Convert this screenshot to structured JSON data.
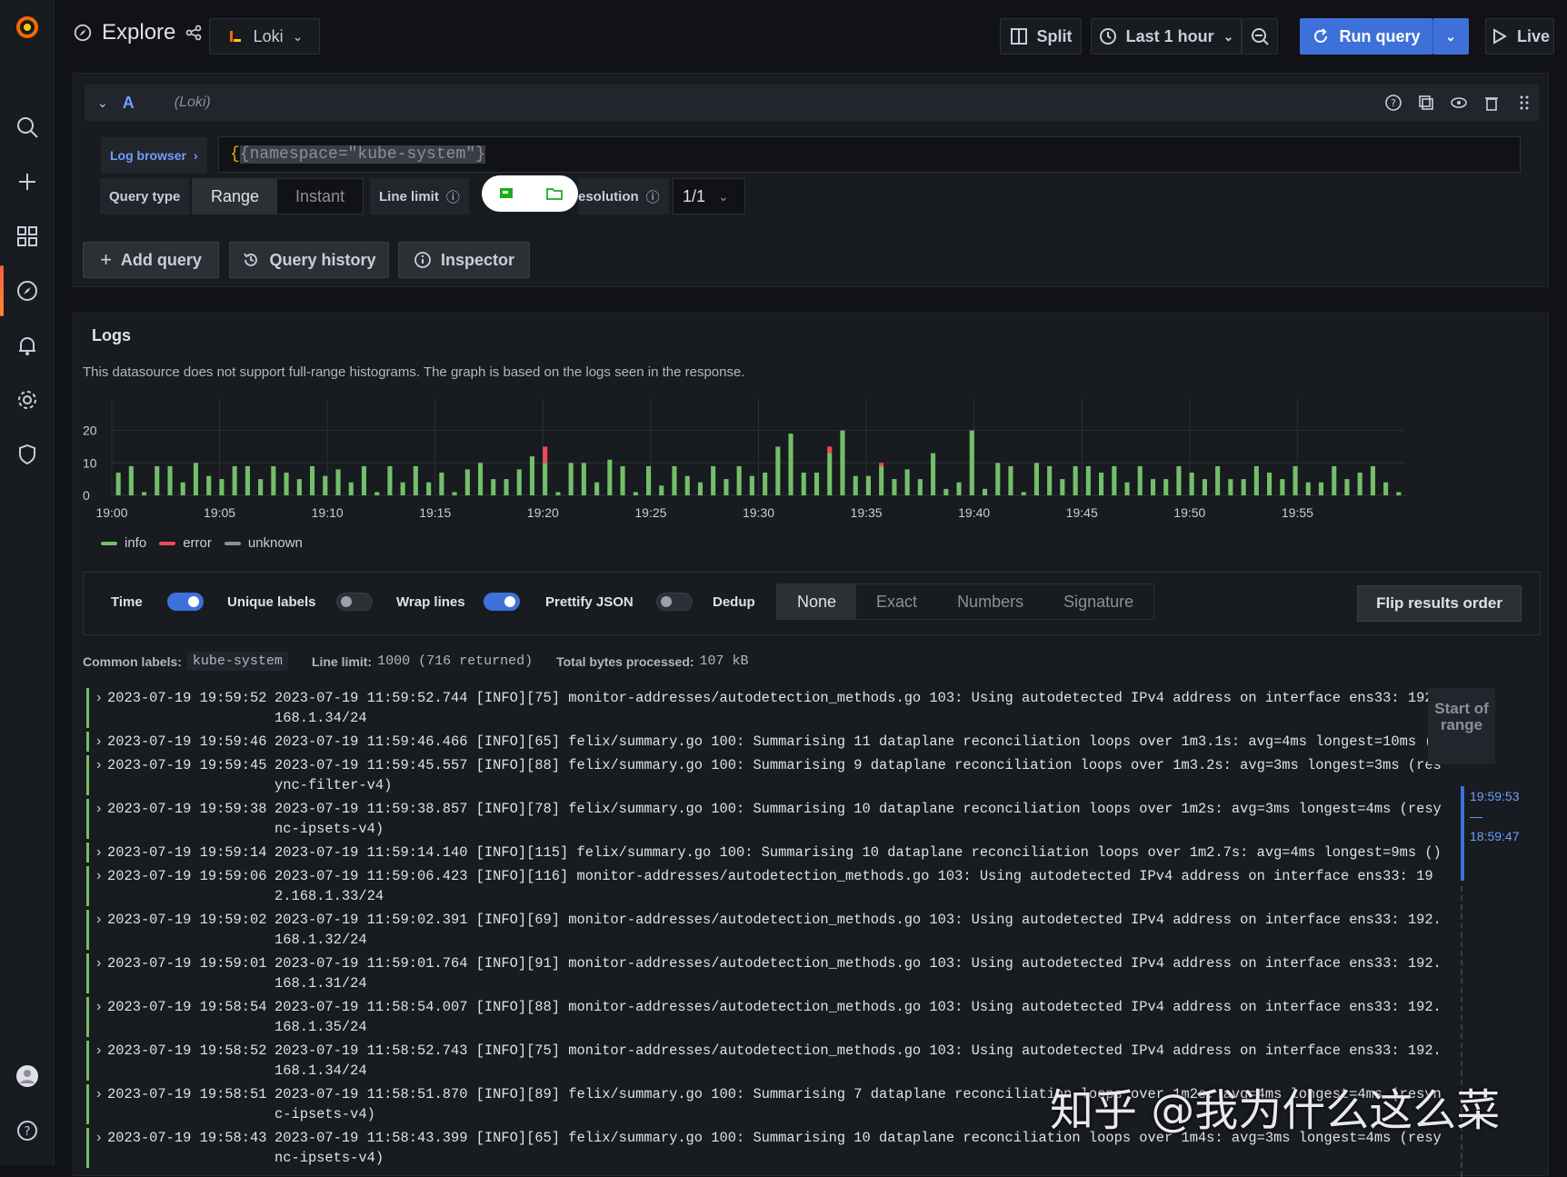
{
  "topbar": {
    "title": "Explore",
    "datasource": "Loki",
    "split_label": "Split",
    "time_range": "Last 1 hour",
    "run_query_label": "Run query",
    "live_label": "Live"
  },
  "query": {
    "ref_id": "A",
    "datasource_hint": "(Loki)",
    "log_browser_label": "Log browser",
    "expression": "{namespace=\"kube-system\"}",
    "query_type_label": "Query type",
    "query_type_options": [
      "Range",
      "Instant"
    ],
    "query_type_selected": "Range",
    "line_limit_label": "Line limit",
    "resolution_label": "esolution",
    "resolution_value": "1/1",
    "add_query_label": "Add query",
    "query_history_label": "Query history",
    "inspector_label": "Inspector"
  },
  "logs": {
    "title": "Logs",
    "note": "This datasource does not support full-range histograms. The graph is based on the logs seen in the response.",
    "legend": [
      {
        "name": "info",
        "color": "#73bf69"
      },
      {
        "name": "error",
        "color": "#f2495c"
      },
      {
        "name": "unknown",
        "color": "#8e8e9a"
      }
    ],
    "options": {
      "time_label": "Time",
      "unique_labels_label": "Unique labels",
      "wrap_lines_label": "Wrap lines",
      "prettify_json_label": "Prettify JSON",
      "dedup_label": "Dedup",
      "dedup_options": [
        "None",
        "Exact",
        "Numbers",
        "Signature"
      ],
      "dedup_selected": "None",
      "flip_label": "Flip results order"
    },
    "common_labels_label": "Common labels:",
    "common_labels_value": "kube-system",
    "line_limit_label": "Line limit:",
    "line_limit_value": "1000 (716 returned)",
    "bytes_label": "Total bytes processed:",
    "bytes_value": "107 kB",
    "range_label": "Start of range",
    "range_from": "19:59:53",
    "range_dash": "—",
    "range_to": "18:59:47",
    "rows": [
      {
        "ts": "2023-07-19 19:59:52",
        "msg": "2023-07-19 11:59:52.744 [INFO][75] monitor-addresses/autodetection_methods.go 103: Using autodetected IPv4 address on interface ens33: 192.168.1.34/24"
      },
      {
        "ts": "2023-07-19 19:59:46",
        "msg": "2023-07-19 11:59:46.466 [INFO][65] felix/summary.go 100: Summarising 11 dataplane reconciliation loops over 1m3.1s: avg=4ms longest=10ms ()"
      },
      {
        "ts": "2023-07-19 19:59:45",
        "msg": "2023-07-19 11:59:45.557 [INFO][88] felix/summary.go 100: Summarising 9 dataplane reconciliation loops over 1m3.2s: avg=3ms longest=3ms (resync-filter-v4)"
      },
      {
        "ts": "2023-07-19 19:59:38",
        "msg": "2023-07-19 11:59:38.857 [INFO][78] felix/summary.go 100: Summarising 10 dataplane reconciliation loops over 1m2s: avg=3ms longest=4ms (resync-ipsets-v4)"
      },
      {
        "ts": "2023-07-19 19:59:14",
        "msg": "2023-07-19 11:59:14.140 [INFO][115] felix/summary.go 100: Summarising 10 dataplane reconciliation loops over 1m2.7s: avg=4ms longest=9ms ()"
      },
      {
        "ts": "2023-07-19 19:59:06",
        "msg": "2023-07-19 11:59:06.423 [INFO][116] monitor-addresses/autodetection_methods.go 103: Using autodetected IPv4 address on interface ens33: 192.168.1.33/24"
      },
      {
        "ts": "2023-07-19 19:59:02",
        "msg": "2023-07-19 11:59:02.391 [INFO][69] monitor-addresses/autodetection_methods.go 103: Using autodetected IPv4 address on interface ens33: 192.168.1.32/24"
      },
      {
        "ts": "2023-07-19 19:59:01",
        "msg": "2023-07-19 11:59:01.764 [INFO][91] monitor-addresses/autodetection_methods.go 103: Using autodetected IPv4 address on interface ens33: 192.168.1.31/24"
      },
      {
        "ts": "2023-07-19 19:58:54",
        "msg": "2023-07-19 11:58:54.007 [INFO][88] monitor-addresses/autodetection_methods.go 103: Using autodetected IPv4 address on interface ens33: 192.168.1.35/24"
      },
      {
        "ts": "2023-07-19 19:58:52",
        "msg": "2023-07-19 11:58:52.743 [INFO][75] monitor-addresses/autodetection_methods.go 103: Using autodetected IPv4 address on interface ens33: 192.168.1.34/24"
      },
      {
        "ts": "2023-07-19 19:58:51",
        "msg": "2023-07-19 11:58:51.870 [INFO][89] felix/summary.go 100: Summarising 7 dataplane reconciliation loops over 1m2s: avg=4ms longest=4ms (resync-ipsets-v4)"
      },
      {
        "ts": "2023-07-19 19:58:43",
        "msg": "2023-07-19 11:58:43.399 [INFO][65] felix/summary.go 100: Summarising 10 dataplane reconciliation loops over 1m4s: avg=3ms longest=4ms (resync-ipsets-v4)"
      }
    ]
  },
  "watermark": "知乎 @我为什么这么菜",
  "chart_data": {
    "type": "bar",
    "stacked": true,
    "yticks": [
      0,
      10,
      20
    ],
    "ylim": [
      0,
      28
    ],
    "xtick_labels": [
      "19:00",
      "19:05",
      "19:10",
      "19:15",
      "19:20",
      "19:25",
      "19:30",
      "19:35",
      "19:40",
      "19:45",
      "19:50",
      "19:55"
    ],
    "series": [
      {
        "name": "info",
        "color": "#73bf69",
        "values": [
          7,
          9,
          1,
          9,
          9,
          4,
          10,
          6,
          5,
          9,
          9,
          5,
          9,
          7,
          5,
          9,
          6,
          8,
          4,
          9,
          1,
          9,
          4,
          9,
          4,
          7,
          1,
          8,
          10,
          5,
          5,
          8,
          12,
          10,
          1,
          10,
          10,
          4,
          11,
          9,
          1,
          9,
          3,
          9,
          6,
          4,
          9,
          5,
          9,
          6,
          7,
          15,
          19,
          7,
          7,
          13,
          20,
          6,
          6,
          9,
          5,
          8,
          5,
          13,
          2,
          4,
          20,
          2,
          10,
          9,
          1,
          10,
          9,
          5,
          9,
          9,
          7,
          9,
          4,
          9,
          5,
          5,
          9,
          7,
          5,
          9,
          5,
          5,
          9,
          7,
          5,
          9,
          4,
          4,
          9,
          5,
          7,
          9,
          4,
          1
        ]
      },
      {
        "name": "error",
        "color": "#f2495c",
        "values": [
          0,
          0,
          0,
          0,
          0,
          0,
          0,
          0,
          0,
          0,
          0,
          0,
          0,
          0,
          0,
          0,
          0,
          0,
          0,
          0,
          0,
          0,
          0,
          0,
          0,
          0,
          0,
          0,
          0,
          0,
          0,
          0,
          0,
          5,
          0,
          0,
          0,
          0,
          0,
          0,
          0,
          0,
          0,
          0,
          0,
          0,
          0,
          0,
          0,
          0,
          0,
          0,
          0,
          0,
          0,
          2,
          0,
          0,
          0,
          1,
          0,
          0,
          0,
          0,
          0,
          0,
          0,
          0,
          0,
          0,
          0,
          0,
          0,
          0,
          0,
          0,
          0,
          0,
          0,
          0,
          0,
          0,
          0,
          0,
          0,
          0,
          0,
          0,
          0,
          0,
          0,
          0,
          0,
          0,
          0,
          0,
          0,
          0,
          0,
          0
        ]
      },
      {
        "name": "unknown",
        "color": "#8e8e9a",
        "values": [
          0,
          0,
          0,
          0,
          0,
          0,
          0,
          0,
          0,
          0,
          0,
          0,
          0,
          0,
          0,
          0,
          0,
          0,
          0,
          0,
          0,
          0,
          0,
          0,
          0,
          0,
          0,
          0,
          0,
          0,
          0,
          0,
          0,
          0,
          0,
          0,
          0,
          0,
          0,
          0,
          0,
          0,
          0,
          0,
          0,
          0,
          0,
          0,
          0,
          0,
          0,
          0,
          0,
          0,
          0,
          0,
          0,
          0,
          0,
          0,
          0,
          0,
          0,
          0,
          0,
          0,
          0,
          0,
          0,
          0,
          0,
          0,
          0,
          0,
          0,
          0,
          0,
          0,
          0,
          0,
          0,
          0,
          0,
          0,
          0,
          0,
          0,
          0,
          0,
          0,
          0,
          0,
          0,
          0,
          0,
          0,
          0,
          0,
          0,
          0
        ]
      }
    ]
  }
}
